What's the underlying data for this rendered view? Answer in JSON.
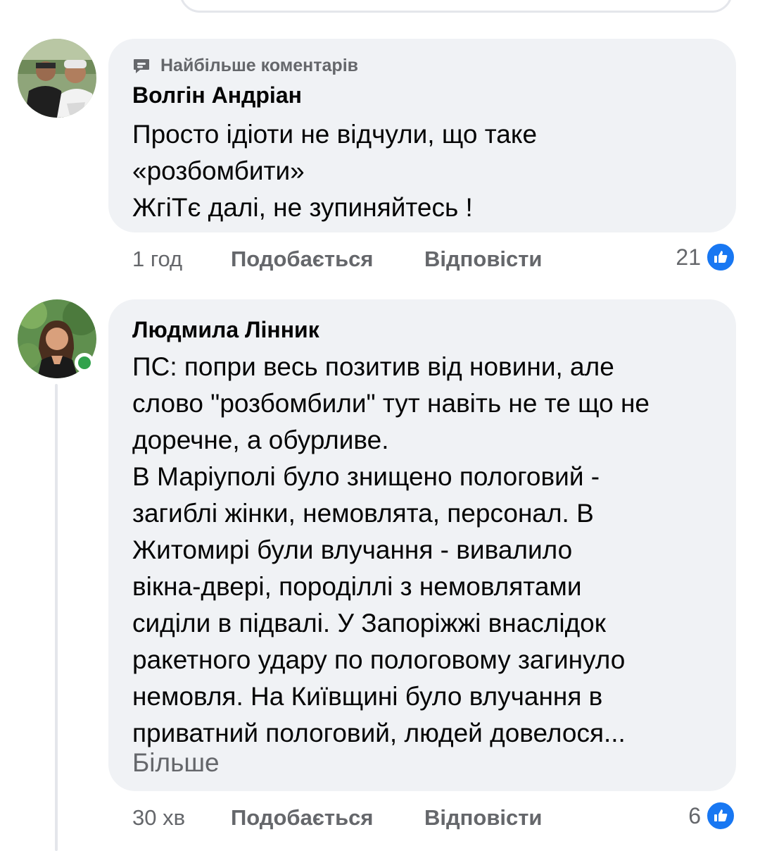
{
  "comments": [
    {
      "badge": "Найбільше коментарів",
      "author": "Волгін Андріан",
      "text_lines": [
        "Просто ідіоти не відчули, що таке",
        "«розбомбити»",
        "ЖгіТє далі, не зупиняйтесь !"
      ],
      "time": "1 год",
      "like_label": "Подобається",
      "reply_label": "Відповісти",
      "reaction_count": "21"
    },
    {
      "author": "Людмила Лінник",
      "text_lines": [
        "ПС: попри весь позитив від новини, але",
        "слово \"розбомбили\" тут навіть не те що не",
        "доречне, а обурливе.",
        "В Маріуполі було знищено пологовий -",
        "загиблі жінки, немовлята, персонал. В",
        "Житомирі були влучання - вивалило",
        "вікна-двері, породіллі з немовлятами",
        "сиділи в підвалі. У Запоріжжі внаслідок",
        "ракетного удару по пологовому загинуло",
        "немовля. На Київщині було влучання в",
        "приватний пологовий, людей довелося..."
      ],
      "more_label": "Більше",
      "time": "30 хв",
      "like_label": "Подобається",
      "reply_label": "Відповісти",
      "reaction_count": "6"
    }
  ],
  "icons": {
    "badge": "chat-bubble-icon",
    "reaction": "thumbs-up-icon"
  },
  "colors": {
    "bubble_bg": "#f0f2f5",
    "secondary_text": "#65676b",
    "like_blue": "#1877f2",
    "online_green": "#31a24c"
  }
}
